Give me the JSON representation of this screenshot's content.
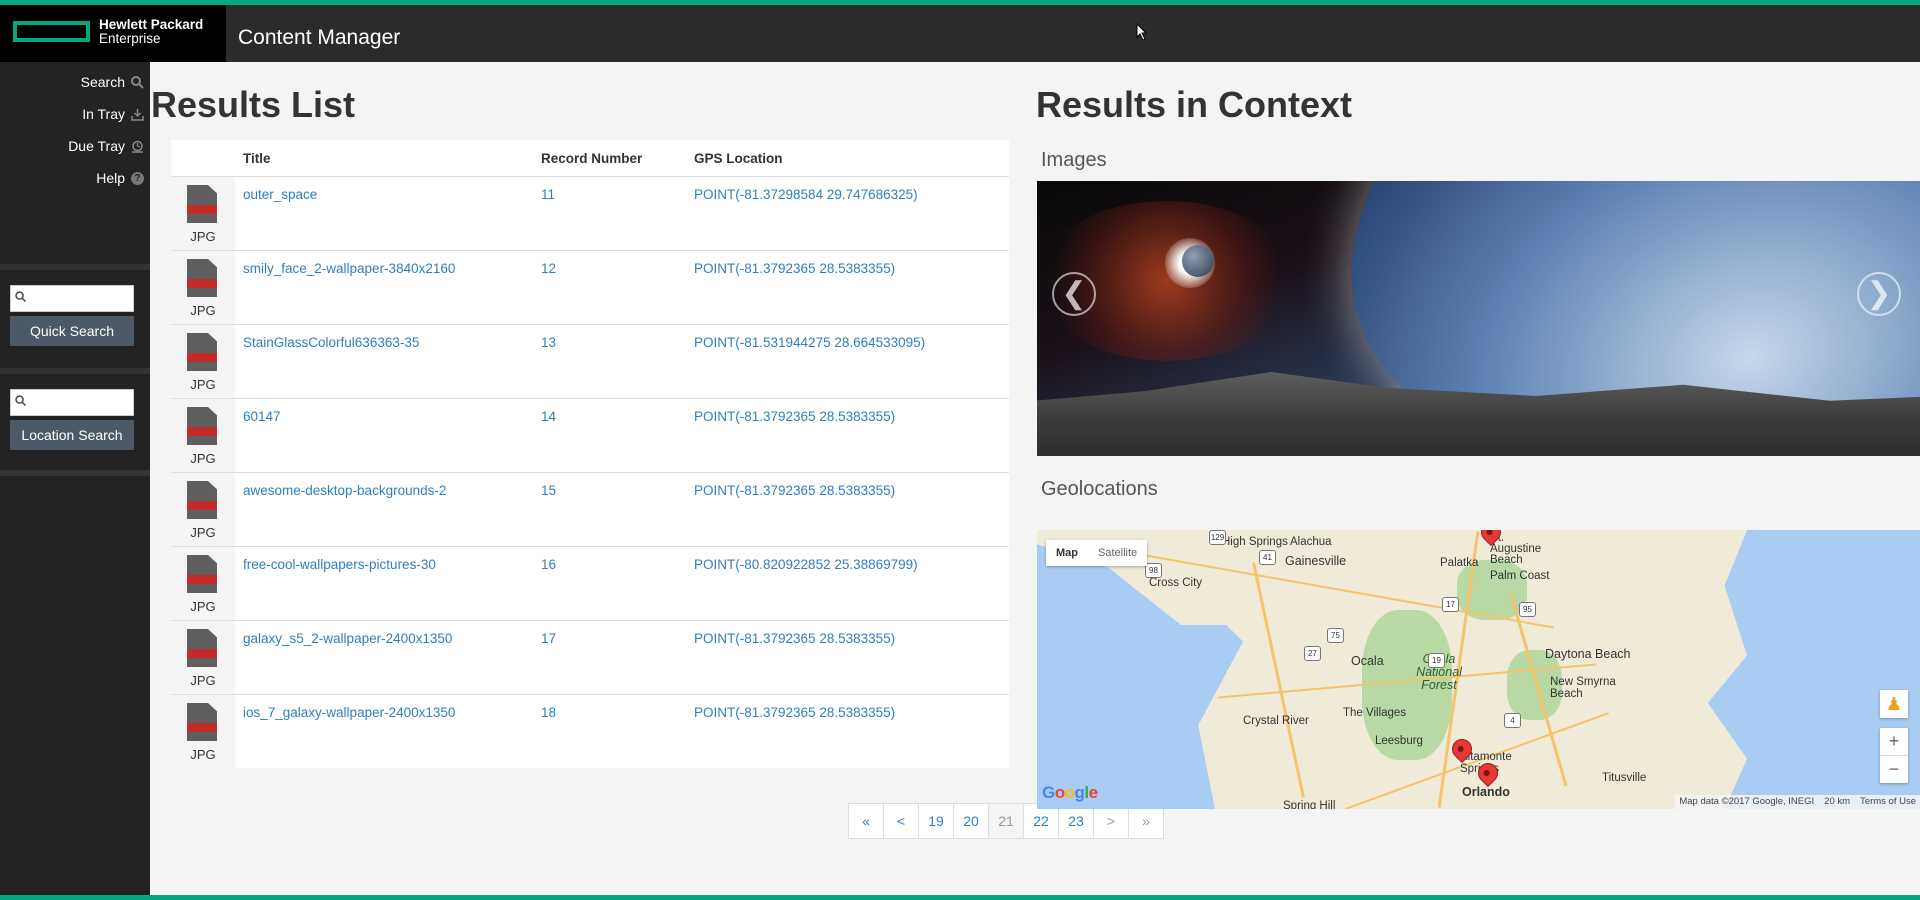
{
  "header": {
    "brand_line1": "Hewlett Packard",
    "brand_line2": "Enterprise",
    "app_title": "Content Manager"
  },
  "sidebar": {
    "nav": [
      {
        "label": "Search",
        "icon": "search-icon"
      },
      {
        "label": "In Tray",
        "icon": "in-tray-icon"
      },
      {
        "label": "Due Tray",
        "icon": "due-tray-icon"
      },
      {
        "label": "Help",
        "icon": "help-icon"
      }
    ],
    "quick_search": {
      "value": "",
      "button": "Quick Search"
    },
    "location_search": {
      "value": "",
      "button": "Location Search"
    }
  },
  "results": {
    "title": "Results List",
    "columns": [
      "Title",
      "Record Number",
      "GPS Location"
    ],
    "rows": [
      {
        "type": "JPG",
        "title": "outer_space",
        "record": "11",
        "gps": "POINT(-81.37298584 29.747686325)"
      },
      {
        "type": "JPG",
        "title": "smily_face_2-wallpaper-3840x2160",
        "record": "12",
        "gps": "POINT(-81.3792365 28.5383355)"
      },
      {
        "type": "JPG",
        "title": "StainGlassColorful636363-35",
        "record": "13",
        "gps": "POINT(-81.531944275 28.664533095)"
      },
      {
        "type": "JPG",
        "title": "60147",
        "record": "14",
        "gps": "POINT(-81.3792365 28.5383355)"
      },
      {
        "type": "JPG",
        "title": "awesome-desktop-backgrounds-2",
        "record": "15",
        "gps": "POINT(-81.3792365 28.5383355)"
      },
      {
        "type": "JPG",
        "title": "free-cool-wallpapers-pictures-30",
        "record": "16",
        "gps": "POINT(-80.820922852 25.38869799)"
      },
      {
        "type": "JPG",
        "title": "galaxy_s5_2-wallpaper-2400x1350",
        "record": "17",
        "gps": "POINT(-81.3792365 28.5383355)"
      },
      {
        "type": "JPG",
        "title": "ios_7_galaxy-wallpaper-2400x1350",
        "record": "18",
        "gps": "POINT(-81.3792365 28.5383355)"
      }
    ]
  },
  "pagination": {
    "first": "«",
    "prev": "<",
    "pages": [
      "19",
      "20",
      "21",
      "22",
      "23"
    ],
    "current": "21",
    "next": ">",
    "last": "»"
  },
  "context": {
    "title": "Results in Context",
    "images_heading": "Images",
    "geolocations_heading": "Geolocations",
    "carousel_prev": "❮",
    "carousel_next": "❯",
    "map": {
      "type_buttons": [
        "Map",
        "Satellite"
      ],
      "selected_type": "Map",
      "places": [
        "Alachua",
        "Gainesville",
        "Palatka",
        "St. Augustine Beach",
        "Palm Coast",
        "Cross City",
        "Ocala",
        "Ocala National Forest",
        "Daytona Beach",
        "New Smyrna Beach",
        "The Villages",
        "Crystal River",
        "Leesburg",
        "Altamonte Springs",
        "Titusville",
        "Orlando",
        "Spring Hill",
        "High Springs"
      ],
      "highways": [
        "129",
        "41",
        "98",
        "75",
        "27",
        "17",
        "95",
        "4",
        "19"
      ],
      "attribution": "Map data ©2017 Google, INEGI",
      "scale": "20 km",
      "terms": "Terms of Use",
      "logo": "Google"
    }
  }
}
